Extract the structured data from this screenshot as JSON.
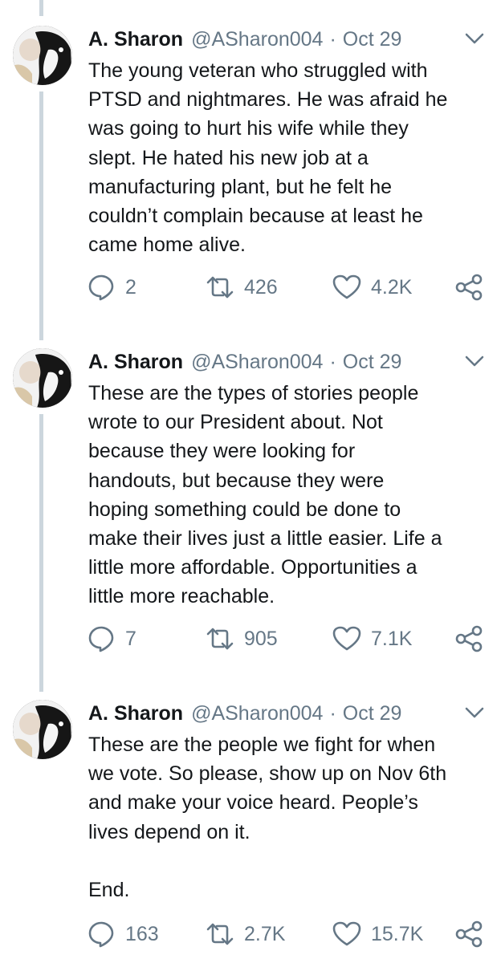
{
  "colors": {
    "text_primary": "#14171a",
    "text_secondary": "#657786",
    "thread_line": "#ccd6dd"
  },
  "icons": {
    "reply": "speech-bubble-icon",
    "retweet": "retweet-arrows-icon",
    "like": "heart-icon",
    "share": "share-icon",
    "menu": "chevron-down-icon"
  },
  "tweets": [
    {
      "name": "A. Sharon",
      "handle": "@ASharon004",
      "separator": "·",
      "date": "Oct 29",
      "text": "The young veteran who struggled with\nPTSD and nightmares. He was afraid he\nwas going to hurt his wife while they\nslept. He hated his new job at a\nmanufacturing plant, but he felt he\ncouldn’t complain because at least he\ncame home alive.",
      "replies": "2",
      "retweets": "426",
      "likes": "4.2K"
    },
    {
      "name": "A. Sharon",
      "handle": "@ASharon004",
      "separator": "·",
      "date": "Oct 29",
      "text": "These are the types of stories people\nwrote to our President about. Not\nbecause they were looking for\nhandouts, but because they were\nhoping something could be done to\nmake their lives just a little easier. Life a\nlittle more affordable. Opportunities a\nlittle more reachable.",
      "replies": "7",
      "retweets": "905",
      "likes": "7.1K"
    },
    {
      "name": "A. Sharon",
      "handle": "@ASharon004",
      "separator": "·",
      "date": "Oct 29",
      "text": "These are the people we fight for when\nwe vote. So please, show up on Nov 6th\nand make your voice heard. People’s\nlives depend on it.\n\nEnd.",
      "replies": "163",
      "retweets": "2.7K",
      "likes": "15.7K"
    }
  ]
}
